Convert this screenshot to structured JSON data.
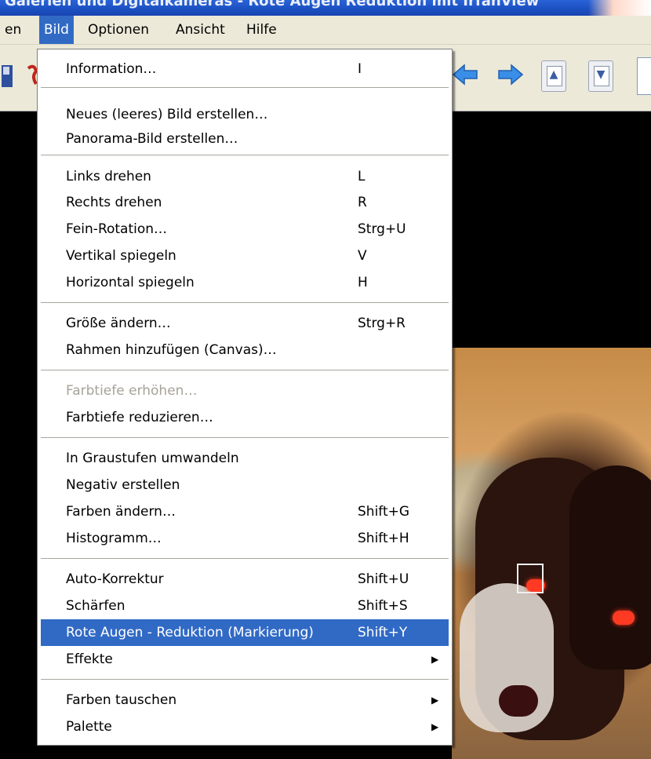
{
  "window": {
    "title": "Galerien und Digitalkameras - Rote Augen Reduktion mit IrfanView"
  },
  "menubar": {
    "items": [
      {
        "label": "en",
        "active": false
      },
      {
        "label": "Bild",
        "active": true
      },
      {
        "label": "Optionen",
        "active": false
      },
      {
        "label": "Ansicht",
        "active": false
      },
      {
        "label": "Hilfe",
        "active": false
      }
    ]
  },
  "toolbar": {
    "icons": [
      "prev-icon",
      "next-icon",
      "page-up-icon",
      "page-down-icon"
    ]
  },
  "menu": {
    "items": [
      {
        "label": "Information…",
        "shortcut": "I"
      },
      {
        "label": "Neues (leeres) Bild erstellen…",
        "shortcut": ""
      },
      {
        "label": "Panorama-Bild erstellen…",
        "shortcut": ""
      },
      {
        "label": "Links drehen",
        "shortcut": "L"
      },
      {
        "label": "Rechts drehen",
        "shortcut": "R"
      },
      {
        "label": "Fein-Rotation…",
        "shortcut": "Strg+U"
      },
      {
        "label": "Vertikal spiegeln",
        "shortcut": "V"
      },
      {
        "label": "Horizontal spiegeln",
        "shortcut": "H"
      },
      {
        "label": "Größe ändern…",
        "shortcut": "Strg+R"
      },
      {
        "label": "Rahmen hinzufügen (Canvas)…",
        "shortcut": ""
      },
      {
        "label": "Farbtiefe erhöhen…",
        "shortcut": "",
        "disabled": true
      },
      {
        "label": "Farbtiefe reduzieren…",
        "shortcut": ""
      },
      {
        "label": "In Graustufen umwandeln",
        "shortcut": ""
      },
      {
        "label": "Negativ erstellen",
        "shortcut": ""
      },
      {
        "label": "Farben ändern…",
        "shortcut": "Shift+G"
      },
      {
        "label": "Histogramm…",
        "shortcut": "Shift+H"
      },
      {
        "label": "Auto-Korrektur",
        "shortcut": "Shift+U"
      },
      {
        "label": "Schärfen",
        "shortcut": "Shift+S"
      },
      {
        "label": "Rote Augen - Reduktion (Markierung)",
        "shortcut": "Shift+Y",
        "highlighted": true
      },
      {
        "label": "Effekte",
        "shortcut": "",
        "submenu": true
      },
      {
        "label": "Farben tauschen",
        "shortcut": "",
        "submenu": true
      },
      {
        "label": "Palette",
        "shortcut": "",
        "submenu": true
      }
    ],
    "submenu_arrow": "▶"
  },
  "colors": {
    "menu_highlight": "#316ac5",
    "menubar_bg": "#ece9d8",
    "title_blue": "#2a63d8",
    "red_eye": "#ff3a22"
  }
}
